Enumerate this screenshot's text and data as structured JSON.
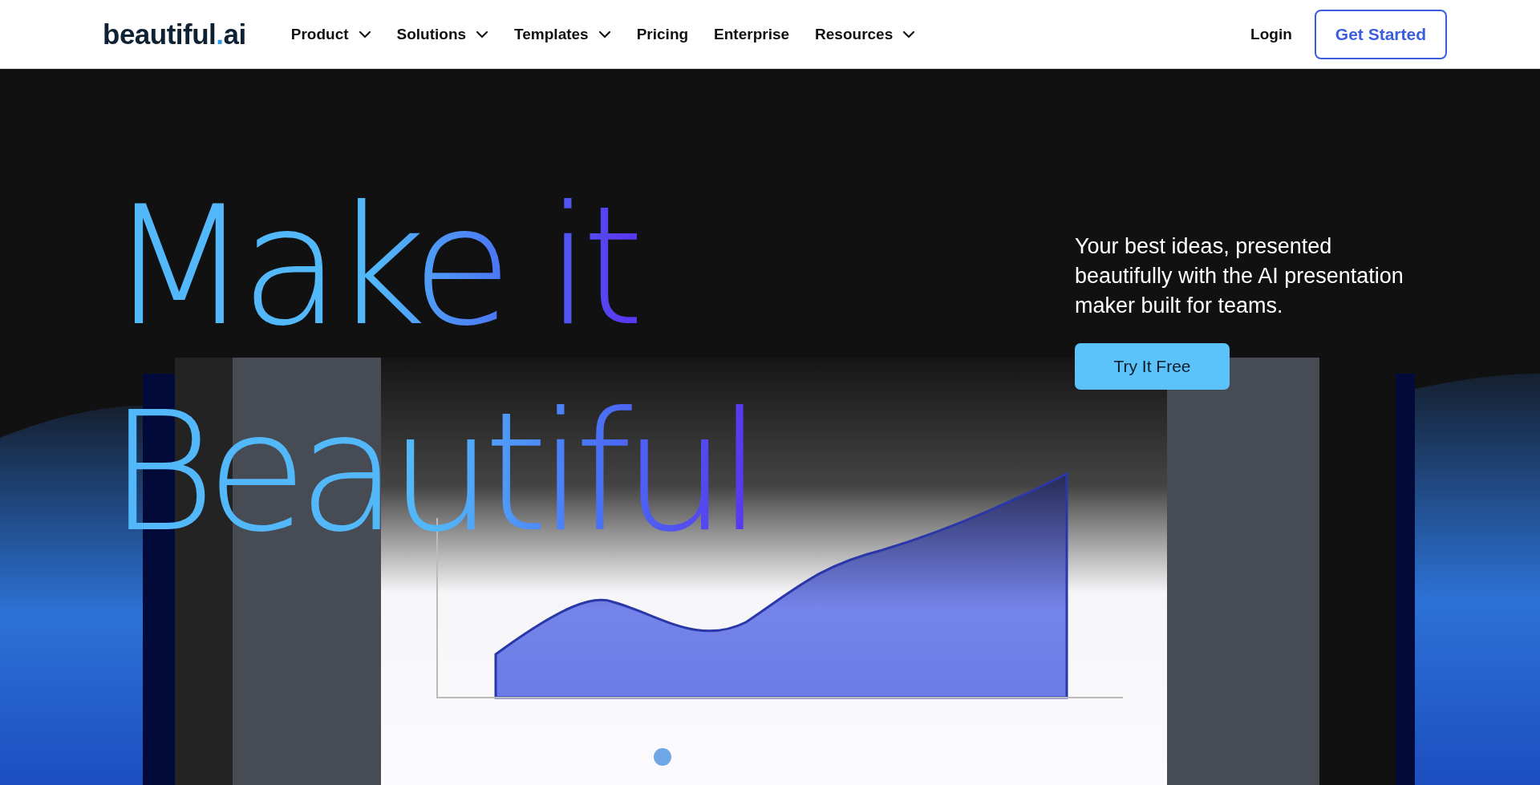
{
  "header": {
    "logo": {
      "word": "beautiful",
      "dot": ".",
      "suffix": "ai"
    },
    "nav": [
      {
        "label": "Product",
        "dropdown": true
      },
      {
        "label": "Solutions",
        "dropdown": true
      },
      {
        "label": "Templates",
        "dropdown": true
      },
      {
        "label": "Pricing",
        "dropdown": false
      },
      {
        "label": "Enterprise",
        "dropdown": false
      },
      {
        "label": "Resources",
        "dropdown": true
      }
    ],
    "login": "Login",
    "cta": "Get Started"
  },
  "hero": {
    "headline": [
      "Make it",
      "Beautiful"
    ],
    "tagline": "Your best ideas, presented beautifully with the AI presentation maker built for teams.",
    "button": "Try It Free"
  }
}
